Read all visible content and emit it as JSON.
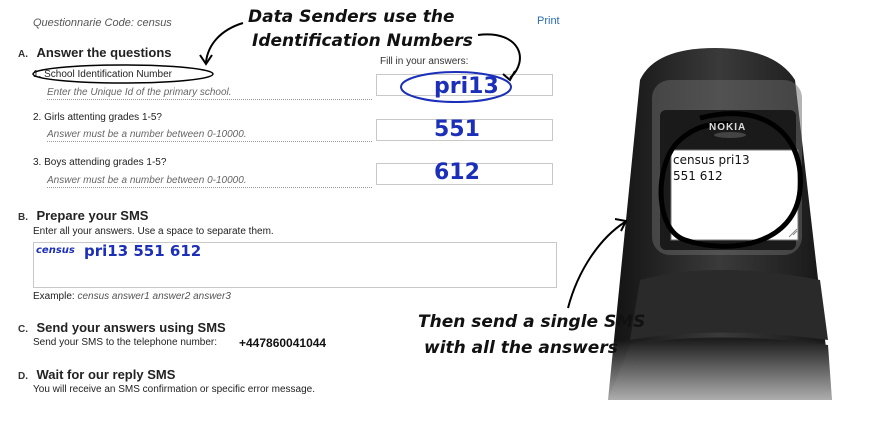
{
  "header": {
    "questionnaire_code": "Questionnarie Code: census",
    "print_label": "Print"
  },
  "section_a": {
    "letter": "A.",
    "title": "Answer the questions",
    "fill_in_label": "Fill in your answers:",
    "questions": [
      {
        "label": "1. School Identification Number",
        "hint": "Enter the Unique Id of the primary school.",
        "value": "pri13"
      },
      {
        "label": "2. Girls attenting grades 1-5?",
        "hint": "Answer must be a number between 0-10000.",
        "value": "551"
      },
      {
        "label": "3. Boys attending grades 1-5?",
        "hint": "Answer must be a number between 0-10000.",
        "value": "612"
      }
    ]
  },
  "section_b": {
    "letter": "B.",
    "title": "Prepare your SMS",
    "instructions": "Enter all your answers. Use a space to separate them.",
    "sms_code": "census",
    "sms_answers": "pri13 551 612",
    "example_label": "Example:",
    "example_value": "census answer1 answer2 answer3"
  },
  "section_c": {
    "letter": "C.",
    "title": "Send your answers using SMS",
    "instructions": "Send your SMS to the telephone number:",
    "phone_number": "+447860041044"
  },
  "section_d": {
    "letter": "D.",
    "title": "Wait for our reply SMS",
    "instructions": "You will receive an SMS confirmation or specific error message."
  },
  "annotations": {
    "top_line1": "Data Senders use the",
    "top_line2": "Identification Numbers",
    "bottom_line1": "Then send a single SMS",
    "bottom_line2": "with all the answers"
  },
  "phone": {
    "brand": "NOKIA",
    "screen_line1": "census pri13",
    "screen_line2": "551 612"
  }
}
